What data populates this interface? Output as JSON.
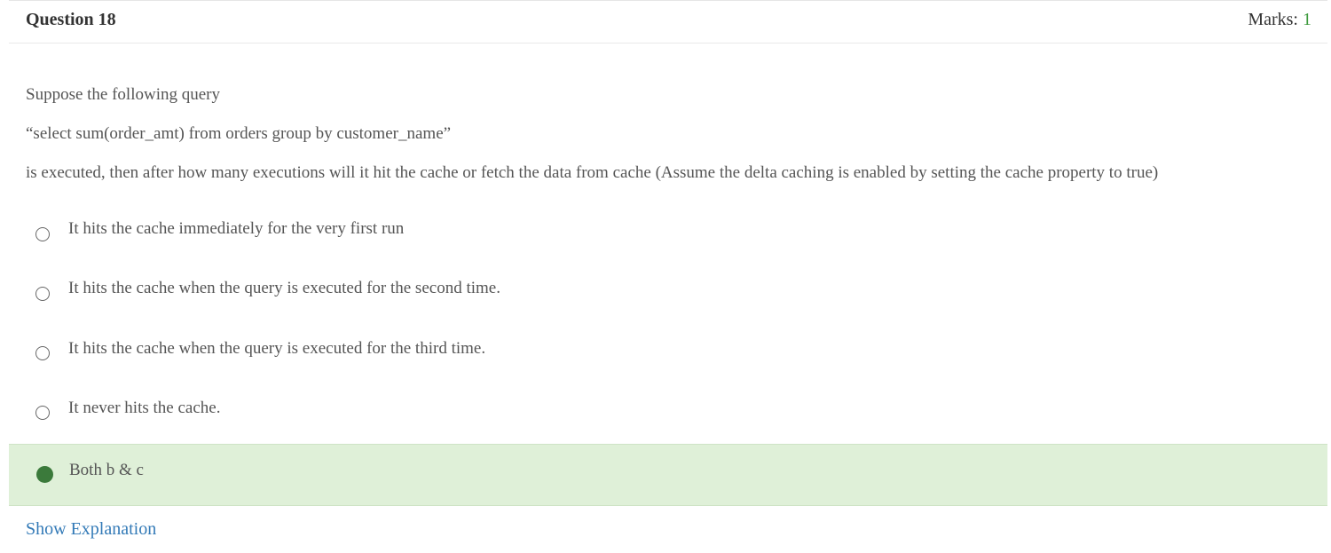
{
  "question": {
    "title": "Question 18",
    "marks_label": "Marks:",
    "marks_value": "1",
    "stem_lines": [
      "Suppose the following query",
      "“select sum(order_amt) from orders group by customer_name”",
      "is executed, then after how many executions will it hit the cache or fetch the data from cache (Assume the delta caching is enabled by setting the cache property to true)"
    ],
    "options": [
      {
        "label": "It hits the cache immediately for the very first run",
        "selected": false
      },
      {
        "label": "It hits the cache when the query is executed for the second time.",
        "selected": false
      },
      {
        "label": "It hits the cache when the query is executed for the third time.",
        "selected": false
      },
      {
        "label": "It never hits the cache.",
        "selected": false
      },
      {
        "label": "Both b & c",
        "selected": true
      }
    ],
    "explanation_link": "Show Explanation"
  },
  "colors": {
    "selected_background": "#dff0d8",
    "selected_radio": "#3b7a3b",
    "marks_value": "#3c9a3c",
    "link": "#337ab7"
  }
}
